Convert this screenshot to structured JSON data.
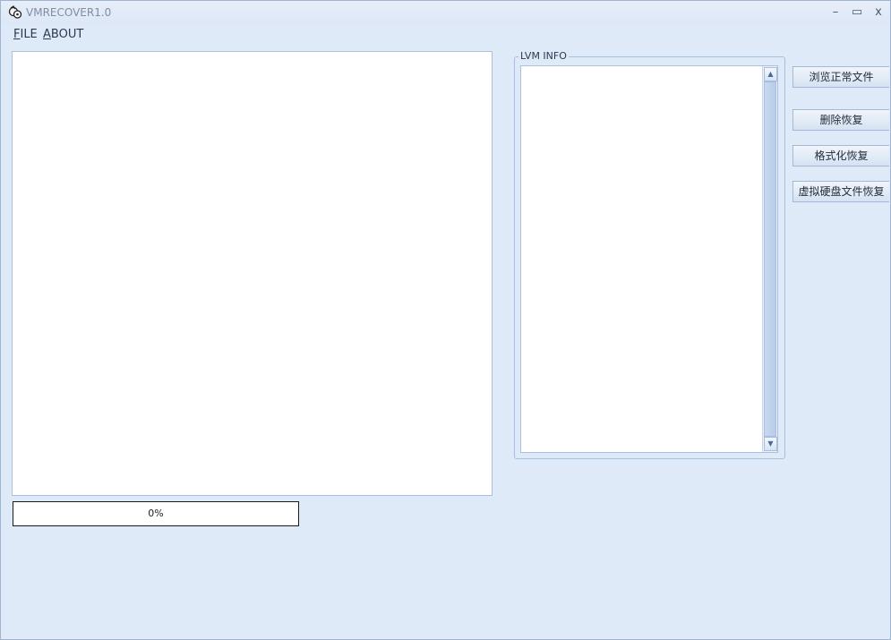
{
  "window": {
    "title": "VMRECOVER1.0",
    "controls": {
      "minimize": "–",
      "maximize": "▭",
      "close": "x"
    }
  },
  "menu": [
    {
      "label": "FILE",
      "mnemonic": "F",
      "rest": "ILE"
    },
    {
      "label": "ABOUT",
      "mnemonic": "A",
      "rest": "BOUT"
    }
  ],
  "progress": {
    "text": "0%",
    "value": 0
  },
  "lvm": {
    "group_label": "LVM INFO"
  },
  "buttons": {
    "browse": "浏览正常文件",
    "delete_recover": "删除恢复",
    "format_recover": "格式化恢复",
    "vdisk_recover": "虚拟硬盘文件恢复"
  }
}
